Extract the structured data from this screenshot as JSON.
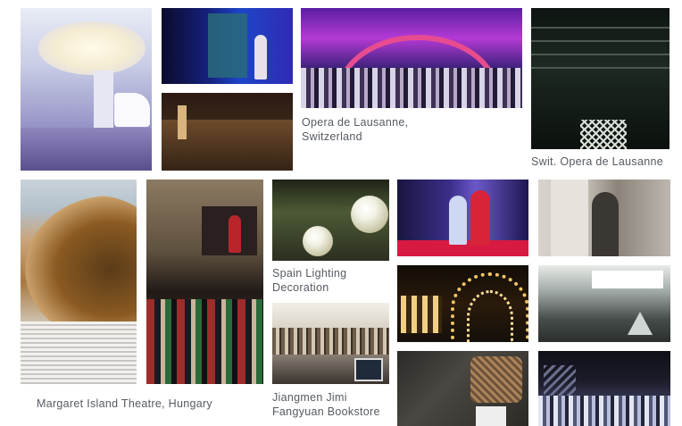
{
  "captions": {
    "lausanne": "Opera de Lausanne,\nSwitzerland",
    "swit_lausanne": "Swit. Opera de Lausanne",
    "spain_lighting": "Spain Lighting\nDecoration",
    "margaret_island": "Margaret Island Theatre, Hungary",
    "jiangmen": "Jiangmen Jimi\nFangyuan Bookstore"
  },
  "colors": {
    "caption_text": "#555b62",
    "background": "#ffffff"
  }
}
